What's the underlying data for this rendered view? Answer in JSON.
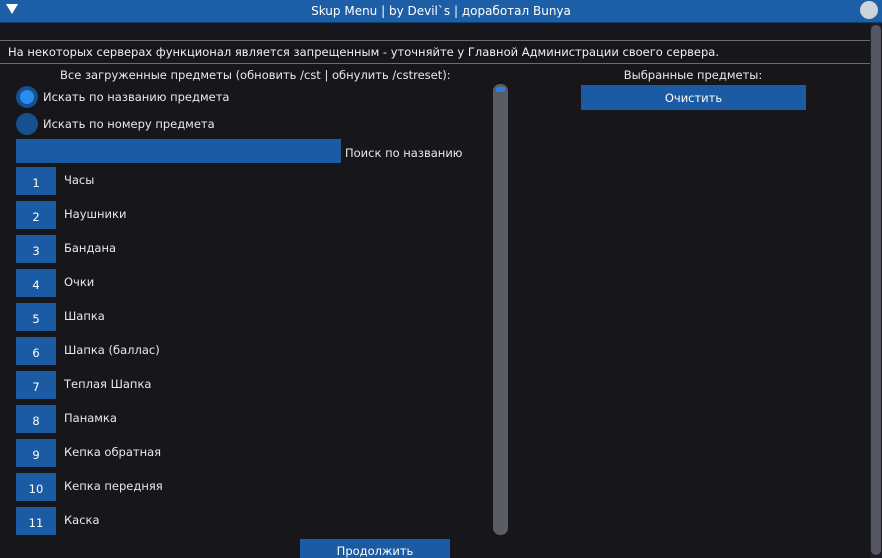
{
  "window": {
    "title": "Skup Menu | by Devil`s | доработал Bunya"
  },
  "warning": "На некоторых серверах функционал является запрещенным - уточняйте у Главной Администрации своего сервера.",
  "left_panel": {
    "header": "Все загруженные предметы (обновить /cst | обнулить /cstreset):",
    "search_mode": [
      {
        "label": "Искать по названию предмета",
        "selected": true
      },
      {
        "label": "Искать по номеру предмета",
        "selected": false
      }
    ],
    "search": {
      "value": "",
      "label": "Поиск по названию"
    },
    "items": [
      {
        "num": "1",
        "name": "Часы"
      },
      {
        "num": "2",
        "name": "Наушники"
      },
      {
        "num": "3",
        "name": "Бандана"
      },
      {
        "num": "4",
        "name": "Очки"
      },
      {
        "num": "5",
        "name": "Шапка"
      },
      {
        "num": "6",
        "name": "Шапка (баллас)"
      },
      {
        "num": "7",
        "name": "Теплая Шапка"
      },
      {
        "num": "8",
        "name": "Панамка"
      },
      {
        "num": "9",
        "name": "Кепка обратная"
      },
      {
        "num": "10",
        "name": "Кепка передняя"
      },
      {
        "num": "11",
        "name": "Каска"
      }
    ]
  },
  "right_panel": {
    "header": "Выбранные предметы:",
    "clear_label": "Очистить"
  },
  "footer": {
    "continue_label": "Продолжить"
  },
  "icons": {
    "collapse": "triangle-down-icon",
    "window_control": "circle-icon"
  },
  "colors": {
    "accent": "#1b5ba3",
    "title_bar": "#1d5fa6",
    "background": "#16161b",
    "radio_active": "#2a8cf0"
  }
}
